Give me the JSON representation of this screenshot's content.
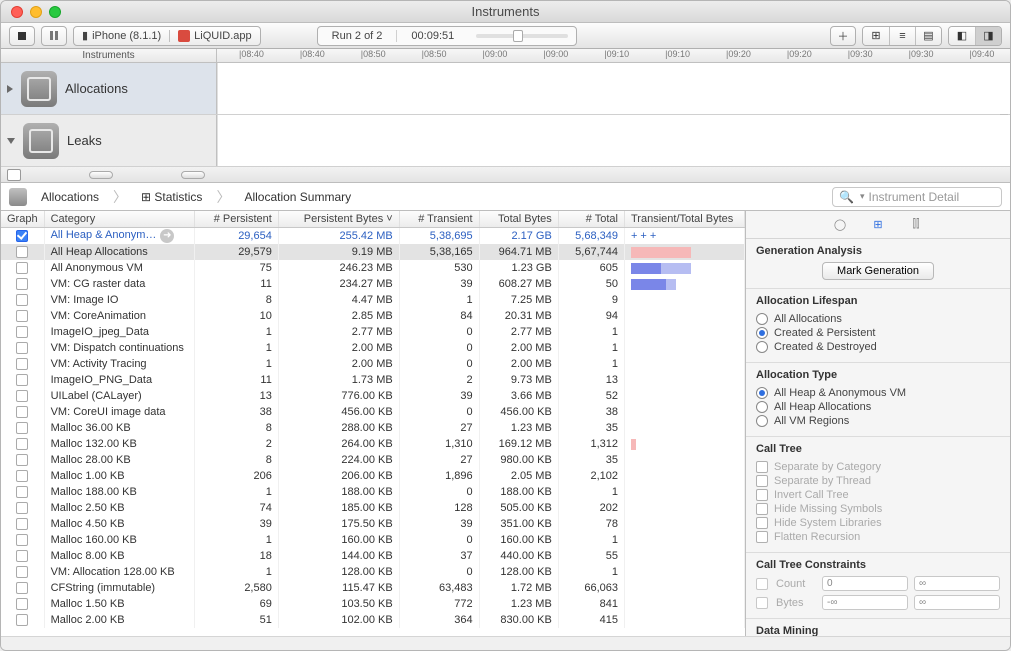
{
  "window": {
    "title": "Instruments"
  },
  "toolbar": {
    "device": "iPhone (8.1.1)",
    "app": "LiQUID.app",
    "run_label": "Run 2 of 2",
    "elapsed": "00:09:51"
  },
  "instr_header_left": "Instruments",
  "timeline_ticks": [
    "|08:40",
    "|08:40",
    "|08:50",
    "|08:50",
    "|09:00",
    "|09:00",
    "|09:10",
    "|09:10",
    "|09:20",
    "|09:20",
    "|09:30",
    "|09:30",
    "|09:40",
    "|09:40"
  ],
  "tracks": [
    {
      "name": "Allocations"
    },
    {
      "name": "Leaks"
    }
  ],
  "jumpbar": {
    "instrument": "Allocations",
    "view_icon_label": "Statistics",
    "summary": "Allocation Summary",
    "search_placeholder": "Instrument Detail"
  },
  "table": {
    "columns": [
      "Graph",
      "Category",
      "# Persistent",
      "Persistent Bytes",
      "# Transient",
      "Total Bytes",
      "# Total",
      "Transient/Total Bytes"
    ],
    "sort_indicator_col": 3,
    "rows": [
      {
        "chk": true,
        "cat": "All Heap & Anonym…",
        "go": true,
        "persN": "29,654",
        "persB": "255.42 MB",
        "tranN": "5,38,695",
        "totB": "2.17 GB",
        "totN": "5,68,349",
        "bar": "+++",
        "hl": true
      },
      {
        "chk": false,
        "cat": "All Heap Allocations",
        "persN": "29,579",
        "persB": "9.19 MB",
        "tranN": "5,38,165",
        "totB": "964.71 MB",
        "totN": "5,67,744",
        "bar": "red60",
        "sel": true
      },
      {
        "chk": false,
        "cat": "All Anonymous VM",
        "persN": "75",
        "persB": "246.23 MB",
        "tranN": "530",
        "totB": "1.23 GB",
        "totN": "605",
        "bar": "blue30_lblue30"
      },
      {
        "chk": false,
        "cat": "VM: CG raster data",
        "persN": "11",
        "persB": "234.27 MB",
        "tranN": "39",
        "totB": "608.27 MB",
        "totN": "50",
        "bar": "blue35_lblue10"
      },
      {
        "chk": false,
        "cat": "VM: Image IO",
        "persN": "8",
        "persB": "4.47 MB",
        "tranN": "1",
        "totB": "7.25 MB",
        "totN": "9",
        "bar": ""
      },
      {
        "chk": false,
        "cat": "VM: CoreAnimation",
        "persN": "10",
        "persB": "2.85 MB",
        "tranN": "84",
        "totB": "20.31 MB",
        "totN": "94",
        "bar": ""
      },
      {
        "chk": false,
        "cat": "ImageIO_jpeg_Data",
        "persN": "1",
        "persB": "2.77 MB",
        "tranN": "0",
        "totB": "2.77 MB",
        "totN": "1",
        "bar": ""
      },
      {
        "chk": false,
        "cat": "VM: Dispatch continuations",
        "persN": "1",
        "persB": "2.00 MB",
        "tranN": "0",
        "totB": "2.00 MB",
        "totN": "1",
        "bar": ""
      },
      {
        "chk": false,
        "cat": "VM: Activity Tracing",
        "persN": "1",
        "persB": "2.00 MB",
        "tranN": "0",
        "totB": "2.00 MB",
        "totN": "1",
        "bar": ""
      },
      {
        "chk": false,
        "cat": "ImageIO_PNG_Data",
        "persN": "11",
        "persB": "1.73 MB",
        "tranN": "2",
        "totB": "9.73 MB",
        "totN": "13",
        "bar": ""
      },
      {
        "chk": false,
        "cat": "UILabel (CALayer)",
        "persN": "13",
        "persB": "776.00 KB",
        "tranN": "39",
        "totB": "3.66 MB",
        "totN": "52",
        "bar": ""
      },
      {
        "chk": false,
        "cat": "VM: CoreUI image data",
        "persN": "38",
        "persB": "456.00 KB",
        "tranN": "0",
        "totB": "456.00 KB",
        "totN": "38",
        "bar": ""
      },
      {
        "chk": false,
        "cat": "Malloc 36.00 KB",
        "persN": "8",
        "persB": "288.00 KB",
        "tranN": "27",
        "totB": "1.23 MB",
        "totN": "35",
        "bar": ""
      },
      {
        "chk": false,
        "cat": "Malloc 132.00 KB",
        "persN": "2",
        "persB": "264.00 KB",
        "tranN": "1,310",
        "totB": "169.12 MB",
        "totN": "1,312",
        "bar": "red5"
      },
      {
        "chk": false,
        "cat": "Malloc 28.00 KB",
        "persN": "8",
        "persB": "224.00 KB",
        "tranN": "27",
        "totB": "980.00 KB",
        "totN": "35",
        "bar": ""
      },
      {
        "chk": false,
        "cat": "Malloc 1.00 KB",
        "persN": "206",
        "persB": "206.00 KB",
        "tranN": "1,896",
        "totB": "2.05 MB",
        "totN": "2,102",
        "bar": ""
      },
      {
        "chk": false,
        "cat": "Malloc 188.00 KB",
        "persN": "1",
        "persB": "188.00 KB",
        "tranN": "0",
        "totB": "188.00 KB",
        "totN": "1",
        "bar": ""
      },
      {
        "chk": false,
        "cat": "Malloc 2.50 KB",
        "persN": "74",
        "persB": "185.00 KB",
        "tranN": "128",
        "totB": "505.00 KB",
        "totN": "202",
        "bar": ""
      },
      {
        "chk": false,
        "cat": "Malloc 4.50 KB",
        "persN": "39",
        "persB": "175.50 KB",
        "tranN": "39",
        "totB": "351.00 KB",
        "totN": "78",
        "bar": ""
      },
      {
        "chk": false,
        "cat": "Malloc 160.00 KB",
        "persN": "1",
        "persB": "160.00 KB",
        "tranN": "0",
        "totB": "160.00 KB",
        "totN": "1",
        "bar": ""
      },
      {
        "chk": false,
        "cat": "Malloc 8.00 KB",
        "persN": "18",
        "persB": "144.00 KB",
        "tranN": "37",
        "totB": "440.00 KB",
        "totN": "55",
        "bar": ""
      },
      {
        "chk": false,
        "cat": "VM: Allocation 128.00 KB",
        "persN": "1",
        "persB": "128.00 KB",
        "tranN": "0",
        "totB": "128.00 KB",
        "totN": "1",
        "bar": ""
      },
      {
        "chk": false,
        "cat": "CFString (immutable)",
        "persN": "2,580",
        "persB": "115.47 KB",
        "tranN": "63,483",
        "totB": "1.72 MB",
        "totN": "66,063",
        "bar": ""
      },
      {
        "chk": false,
        "cat": "Malloc 1.50 KB",
        "persN": "69",
        "persB": "103.50 KB",
        "tranN": "772",
        "totB": "1.23 MB",
        "totN": "841",
        "bar": ""
      },
      {
        "chk": false,
        "cat": "Malloc 2.00 KB",
        "persN": "51",
        "persB": "102.00 KB",
        "tranN": "364",
        "totB": "830.00 KB",
        "totN": "415",
        "bar": ""
      }
    ]
  },
  "inspector": {
    "gen_title": "Generation Analysis",
    "gen_button": "Mark Generation",
    "lifespan_title": "Allocation Lifespan",
    "lifespan_opts": [
      "All Allocations",
      "Created & Persistent",
      "Created & Destroyed"
    ],
    "lifespan_sel": 1,
    "type_title": "Allocation Type",
    "type_opts": [
      "All Heap & Anonymous VM",
      "All Heap Allocations",
      "All VM Regions"
    ],
    "type_sel": 0,
    "calltree_title": "Call Tree",
    "calltree_opts": [
      "Separate by Category",
      "Separate by Thread",
      "Invert Call Tree",
      "Hide Missing Symbols",
      "Hide System Libraries",
      "Flatten Recursion"
    ],
    "constraints_title": "Call Tree Constraints",
    "constraints": [
      {
        "label": "Count",
        "min": "0",
        "max": "∞"
      },
      {
        "label": "Bytes",
        "min": "-∞",
        "max": "∞"
      }
    ],
    "datamining_title": "Data Mining"
  }
}
